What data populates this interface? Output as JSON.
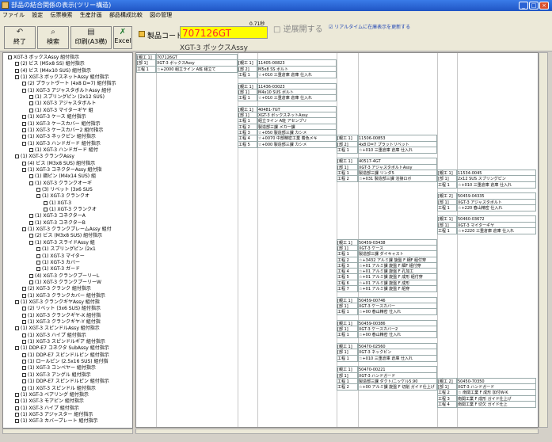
{
  "window": {
    "title": "部品の結合関係の表示(ツリー構造)",
    "minimize": "_",
    "maximize": "□",
    "close": "×"
  },
  "menu": [
    "ファイル",
    "設定",
    "伝票検索",
    "生産計画",
    "部品構成比較",
    "図の管理"
  ],
  "toolbar": {
    "exit": "終了",
    "search": "検索",
    "print": "印刷(A3横)",
    "excel": "Excel",
    "product_code_label": "製品コード",
    "product_code": "707126GT",
    "version": "0.71秒",
    "product_name": "XGT-3 ボックスAssy",
    "reverse_label": "逆展開する",
    "realtime_label": "リアルタイムに在庫表示を更新する"
  },
  "tree": [
    {
      "d": 0,
      "t": "XGT-3 ボックスAssy 組付指示"
    },
    {
      "d": 1,
      "t": "(2) ビス (M5x8 SS) 組付指示"
    },
    {
      "d": 1,
      "t": "(4) ビス (M4x10 SUS) 組付指示"
    },
    {
      "d": 1,
      "t": "(1) XGT-3 ボックスネットAssy 組付指示"
    },
    {
      "d": 2,
      "t": "(2) プラットヴート (4x8 D=7) 組付指示"
    },
    {
      "d": 2,
      "t": "(1) XGT-3 アジャスタボルトAssy 組付"
    },
    {
      "d": 3,
      "t": "(1) スプリングピン (2x12 SUS)"
    },
    {
      "d": 3,
      "t": "(1) XGT-3 アジャスタボルト"
    },
    {
      "d": 3,
      "t": "(1) XGT-3 マイターギヤ 組"
    },
    {
      "d": 2,
      "t": "(1) XGT-3 ケース 組付指示"
    },
    {
      "d": 2,
      "t": "(1) XGT-3 ケースカバー 組付指示"
    },
    {
      "d": 2,
      "t": "(1) XGT-3 ケースカバー2 組付指示"
    },
    {
      "d": 2,
      "t": "(1) XGT-3 ネックピン 組付指示"
    },
    {
      "d": 2,
      "t": "(1) XGT-3 ハンドガード 組付指示"
    },
    {
      "d": 3,
      "t": "(1) XGT-3 ハンドガード 組付"
    },
    {
      "d": 1,
      "t": "(1) XGT-3 クランクAssy"
    },
    {
      "d": 2,
      "t": "(4) ビス (M3x8 SUS) 組付指示"
    },
    {
      "d": 2,
      "t": "(1) XGT-3 コネクターAssy 組付指"
    },
    {
      "d": 3,
      "t": "(1) 鋼ピン (M4x14 SUS) 組"
    },
    {
      "d": 3,
      "t": "(1) XGT-3 クランクオーギ"
    },
    {
      "d": 4,
      "t": "(3) リベット (3x6 SUS"
    },
    {
      "d": 4,
      "t": "(1) XGT-3 クランクオ"
    },
    {
      "d": 5,
      "t": "(1) XGT-3"
    },
    {
      "d": 5,
      "t": "(1) XGT-3 クランクオ"
    },
    {
      "d": 3,
      "t": "(1) XGT-3 コネクターA"
    },
    {
      "d": 3,
      "t": "(1) XGT-3 コネクターB"
    },
    {
      "d": 2,
      "t": "(1) XGT-3 クランクプレームAssy 組付"
    },
    {
      "d": 3,
      "t": "(2) ビス (M3x8 SUS) 組付指示"
    },
    {
      "d": 3,
      "t": "(1) XGT-3 スライドAssy 組"
    },
    {
      "d": 4,
      "t": "(1) スプリングピン (2x1"
    },
    {
      "d": 4,
      "t": "(1) XGT-3 マイター"
    },
    {
      "d": 4,
      "t": "(1) XGT-3 カバー"
    },
    {
      "d": 4,
      "t": "(1) XGT-3 ガード"
    },
    {
      "d": 3,
      "t": "(4) XGT-3 クランクプーリーL"
    },
    {
      "d": 3,
      "t": "(1) XGT-3 クランクプーリーW"
    },
    {
      "d": 2,
      "t": "(2) XGT-3 クランク 組付指示"
    },
    {
      "d": 2,
      "t": "(1) XGT-3 クランクカバー 組付指示"
    },
    {
      "d": 1,
      "t": "(1) XGT-3 クランクギヤAssy 組付指"
    },
    {
      "d": 2,
      "t": "(2) リベット (3x6 SUS) 組付指示"
    },
    {
      "d": 2,
      "t": "(1) XGT-3 クランクギヤ-X 組付指"
    },
    {
      "d": 2,
      "t": "(1) XGT-3 クランクギヤ-Y 組付指"
    },
    {
      "d": 1,
      "t": "(1) XGT-3 スピンドルAssy 組付指示"
    },
    {
      "d": 2,
      "t": "(1) XGT-3 ハイプ 組付指示"
    },
    {
      "d": 2,
      "t": "(1) XGT-3 スピンドルギア 組付指示"
    },
    {
      "d": 1,
      "t": "(1) DDP-E7 コネクタ SubAssy 組付指示"
    },
    {
      "d": 2,
      "t": "(1) DDP-E7 スピンドルピン 組付指示"
    },
    {
      "d": 2,
      "t": "(1) ロールピン (2.5x16 SUS) 組付指"
    },
    {
      "d": 2,
      "t": "(1) XGT-3 コンベヤー 組付指示"
    },
    {
      "d": 2,
      "t": "(1) XGT-3 アングル 組付指示"
    },
    {
      "d": 2,
      "t": "(1) DDP-E7 スピンドルピン 組付指示"
    },
    {
      "d": 2,
      "t": "(1) XGT-3 スピンドル 組付指示"
    },
    {
      "d": 1,
      "t": "(1) XGT-3 ベアリング 組付指示"
    },
    {
      "d": 1,
      "t": "(1) XGT-3 モアピン 組付指示"
    },
    {
      "d": 1,
      "t": "(1) XGT-3 ハイプ 組付指示"
    },
    {
      "d": 1,
      "t": "(1) XGT-3 アジャスター 組付指示"
    },
    {
      "d": 1,
      "t": "(1) XGT-3 カバープレート 組付指示"
    }
  ],
  "grid": [
    {
      "c": 0,
      "r": 0,
      "t": "[親工 1]"
    },
    {
      "c": 1,
      "r": 0,
      "t": "707126GT"
    },
    {
      "c": 0,
      "r": 1,
      "t": "[部 1]"
    },
    {
      "c": 1,
      "r": 1,
      "t": "XGT-3 ボックスAssy"
    },
    {
      "c": 0,
      "r": 2,
      "t": "工程 1"
    },
    {
      "c": 1,
      "r": 2,
      "t": "☆+2000 組立ライン A班 組立て"
    },
    {
      "c": 2,
      "r": 1,
      "t": "[親工 1]"
    },
    {
      "c": 3,
      "r": 1,
      "t": "11405-00823"
    },
    {
      "c": 2,
      "r": 2,
      "t": "[部 2]"
    },
    {
      "c": 3,
      "r": 2,
      "t": "M5x8 SS ボルト"
    },
    {
      "c": 2,
      "r": 3,
      "t": "工程 1"
    },
    {
      "c": 3,
      "r": 3,
      "t": "☆+010 三重倉庫 倉庫 仕入れ"
    },
    {
      "c": 2,
      "r": 5,
      "t": "[親工 1]"
    },
    {
      "c": 3,
      "r": 5,
      "t": "11436-03023"
    },
    {
      "c": 2,
      "r": 6,
      "t": "[部 1]"
    },
    {
      "c": 3,
      "r": 6,
      "t": "M4x10 SUS ボルト"
    },
    {
      "c": 2,
      "r": 7,
      "t": "工程 1"
    },
    {
      "c": 3,
      "r": 7,
      "t": "☆+010 三重倉庫 倉庫 仕入れ"
    },
    {
      "c": 2,
      "r": 9,
      "t": "[親工 1]"
    },
    {
      "c": 3,
      "r": 9,
      "t": "40481-7GT"
    },
    {
      "c": 2,
      "r": 10,
      "t": "[部 1]"
    },
    {
      "c": 3,
      "r": 10,
      "t": "XGT-3 ボックスネットAssy"
    },
    {
      "c": 2,
      "r": 11,
      "t": "工程 1"
    },
    {
      "c": 3,
      "r": 11,
      "t": "組立ライン A班 アセンブリ"
    },
    {
      "c": 2,
      "r": 12,
      "t": "工程 2"
    },
    {
      "c": 3,
      "r": 12,
      "t": "製造部三課 メカ一課"
    },
    {
      "c": 2,
      "r": 13,
      "t": "工程 3"
    },
    {
      "c": 3,
      "r": 13,
      "t": "☆+050 製造部三課 カシメ"
    },
    {
      "c": 2,
      "r": 14,
      "t": "工程 4"
    },
    {
      "c": 3,
      "r": 14,
      "t": "☆+0070 中部精密工業 着色メキ"
    },
    {
      "c": 2,
      "r": 15,
      "t": "工程 5"
    },
    {
      "c": 3,
      "r": 15,
      "t": "☆+000 製造部三課 カシメ"
    },
    {
      "c": 4,
      "r": 14,
      "t": "[親工 1]"
    },
    {
      "c": 5,
      "r": 14,
      "t": "11506-00853"
    },
    {
      "c": 4,
      "r": 15,
      "t": "[部 2]"
    },
    {
      "c": 5,
      "r": 15,
      "t": "4x8 D=7 プラットリベット"
    },
    {
      "c": 4,
      "r": 16,
      "t": "工程 1"
    },
    {
      "c": 5,
      "r": 16,
      "t": "☆+010 三重倉庫 倉庫 仕入れ"
    },
    {
      "c": 4,
      "r": 18,
      "t": "[親工 1]"
    },
    {
      "c": 5,
      "r": 18,
      "t": "40517-4GT"
    },
    {
      "c": 4,
      "r": 19,
      "t": "[部 1]"
    },
    {
      "c": 5,
      "r": 19,
      "t": "XGT-3 アジャスタボルトAssy"
    },
    {
      "c": 4,
      "r": 20,
      "t": "工程 1"
    },
    {
      "c": 5,
      "r": 20,
      "t": "製造部三課 リンダ5"
    },
    {
      "c": 4,
      "r": 21,
      "t": "工程 2"
    },
    {
      "c": 5,
      "r": 21,
      "t": "☆+031 製造部三課 溶接ロボ"
    },
    {
      "c": 6,
      "r": 20,
      "t": "[親工 1]"
    },
    {
      "c": 7,
      "r": 20,
      "t": "11534-0045"
    },
    {
      "c": 6,
      "r": 21,
      "t": "[部 1]"
    },
    {
      "c": 7,
      "r": 21,
      "t": "2x12 SUS スプリングピン"
    },
    {
      "c": 6,
      "r": 22,
      "t": "工程 1"
    },
    {
      "c": 7,
      "r": 22,
      "t": "☆+010 三重倉庫 倉庫 仕入れ"
    },
    {
      "c": 6,
      "r": 24,
      "t": "[親工 2]"
    },
    {
      "c": 7,
      "r": 24,
      "t": "50459-04335"
    },
    {
      "c": 6,
      "r": 25,
      "t": "[部 1]"
    },
    {
      "c": 7,
      "r": 25,
      "t": "XGT-3 アジャスタボルト"
    },
    {
      "c": 6,
      "r": 26,
      "t": "工程 1"
    },
    {
      "c": 7,
      "r": 26,
      "t": "☆+220 春山精密 仕入れ"
    },
    {
      "c": 6,
      "r": 28,
      "t": "[親工 1]"
    },
    {
      "c": 7,
      "r": 28,
      "t": "50460-03672"
    },
    {
      "c": 6,
      "r": 29,
      "t": "[部 1]"
    },
    {
      "c": 7,
      "r": 29,
      "t": "XGT-3 マイターギヤ"
    },
    {
      "c": 6,
      "r": 30,
      "t": "工程 1"
    },
    {
      "c": 7,
      "r": 30,
      "t": "☆+2220 三重倉庫 倉庫 仕入れ"
    },
    {
      "c": 4,
      "r": 32,
      "t": "[親工 1]"
    },
    {
      "c": 5,
      "r": 32,
      "t": "50459-03438"
    },
    {
      "c": 4,
      "r": 33,
      "t": "[部 1]"
    },
    {
      "c": 5,
      "r": 33,
      "t": "XGT-3 ケース"
    },
    {
      "c": 4,
      "r": 34,
      "t": "工程 1"
    },
    {
      "c": 5,
      "r": 34,
      "t": "製造部三課 ダイキャスト"
    },
    {
      "c": 4,
      "r": 35,
      "t": "工程 2"
    },
    {
      "c": 5,
      "r": 35,
      "t": "☆+3432 アルミ課 旋盤 F 細F 組付穿"
    },
    {
      "c": 4,
      "r": 36,
      "t": "工程 3"
    },
    {
      "c": 5,
      "r": 36,
      "t": "☆+01 アルミ課 旋盤 F 細F 組付穿"
    },
    {
      "c": 4,
      "r": 37,
      "t": "工程 4"
    },
    {
      "c": 5,
      "r": 37,
      "t": "☆+01 アルミ課 旋盤 F 孔加工"
    },
    {
      "c": 4,
      "r": 38,
      "t": "工程 5"
    },
    {
      "c": 5,
      "r": 38,
      "t": "☆+01 アルミ課 旋盤 F 成形 組付穿"
    },
    {
      "c": 4,
      "r": 39,
      "t": "工程 6"
    },
    {
      "c": 5,
      "r": 39,
      "t": "☆+01 アルミ課 旋盤 F 成形"
    },
    {
      "c": 4,
      "r": 40,
      "t": "工程 7"
    },
    {
      "c": 5,
      "r": 40,
      "t": "☆+01 アルミ課 旋盤 F 組穿"
    },
    {
      "c": 4,
      "r": 42,
      "t": "[親工 1]"
    },
    {
      "c": 5,
      "r": 42,
      "t": "50459-00746"
    },
    {
      "c": 4,
      "r": 43,
      "t": "[部 1]"
    },
    {
      "c": 5,
      "r": 43,
      "t": "XGT-3 ケースカバー"
    },
    {
      "c": 4,
      "r": 44,
      "t": "工程 1"
    },
    {
      "c": 5,
      "r": 44,
      "t": "☆+00 春山精密 仕入れ"
    },
    {
      "c": 4,
      "r": 46,
      "t": "[親工 1]"
    },
    {
      "c": 5,
      "r": 46,
      "t": "50459-00386"
    },
    {
      "c": 4,
      "r": 47,
      "t": "[部 1]"
    },
    {
      "c": 5,
      "r": 47,
      "t": "XGT-3 ケースカバー2"
    },
    {
      "c": 4,
      "r": 48,
      "t": "工程 1"
    },
    {
      "c": 5,
      "r": 48,
      "t": "☆+00 春山精密 仕入れ"
    },
    {
      "c": 4,
      "r": 50,
      "t": "[親工 1]"
    },
    {
      "c": 5,
      "r": 50,
      "t": "50470-02560"
    },
    {
      "c": 4,
      "r": 51,
      "t": "[部 1]"
    },
    {
      "c": 5,
      "r": 51,
      "t": "XGT-3 ネックピン"
    },
    {
      "c": 4,
      "r": 52,
      "t": "工程 1"
    },
    {
      "c": 5,
      "r": 52,
      "t": "☆+010 三重倉庫 倉庫 仕入れ"
    },
    {
      "c": 4,
      "r": 54,
      "t": "[親工 1]"
    },
    {
      "c": 5,
      "r": 54,
      "t": "50470-00221"
    },
    {
      "c": 4,
      "r": 55,
      "t": "[部 1]"
    },
    {
      "c": 5,
      "r": 55,
      "t": "XGT-3 ハンドガード"
    },
    {
      "c": 4,
      "r": 56,
      "t": "工程 1"
    },
    {
      "c": 5,
      "r": 56,
      "t": "製造部三課 ダクト/ニッケル5.90"
    },
    {
      "c": 4,
      "r": 57,
      "t": "工程 2"
    },
    {
      "c": 5,
      "r": 57,
      "t": "☆+00 アルミ課 旋盤 F 切削 ガイド仕上げ"
    },
    {
      "c": 6,
      "r": 56,
      "t": "[親工 2]"
    },
    {
      "c": 7,
      "r": 56,
      "t": "50450-70350"
    },
    {
      "c": 6,
      "r": 57,
      "t": "[部 1]"
    },
    {
      "c": 7,
      "r": 57,
      "t": "XGT-3 ハンドガード"
    },
    {
      "c": 6,
      "r": 58,
      "t": "工程 2"
    },
    {
      "c": 7,
      "r": 58,
      "t": "☆ 南関工業 F 成形 加付W-K"
    },
    {
      "c": 6,
      "r": 59,
      "t": "工程 3"
    },
    {
      "c": 7,
      "r": 59,
      "t": "南関工業 F 成形 ガイド仕上げ"
    },
    {
      "c": 6,
      "r": 60,
      "t": "工程 4"
    },
    {
      "c": 7,
      "r": 60,
      "t": "南関工業 F 切欠 ガイド仕上"
    }
  ]
}
